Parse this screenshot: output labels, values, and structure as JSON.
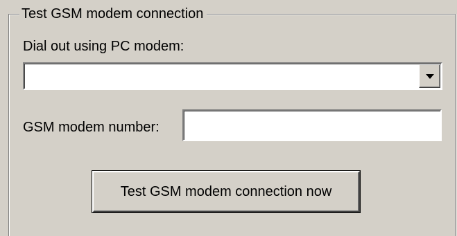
{
  "group": {
    "title": "Test GSM modem connection"
  },
  "dial_out": {
    "label": "Dial out using PC modem:",
    "selected_value": "",
    "dropdown_icon": "chevron-down-icon"
  },
  "gsm_number": {
    "label": "GSM modem number:",
    "value": ""
  },
  "test_button": {
    "label": "Test GSM modem connection now"
  }
}
